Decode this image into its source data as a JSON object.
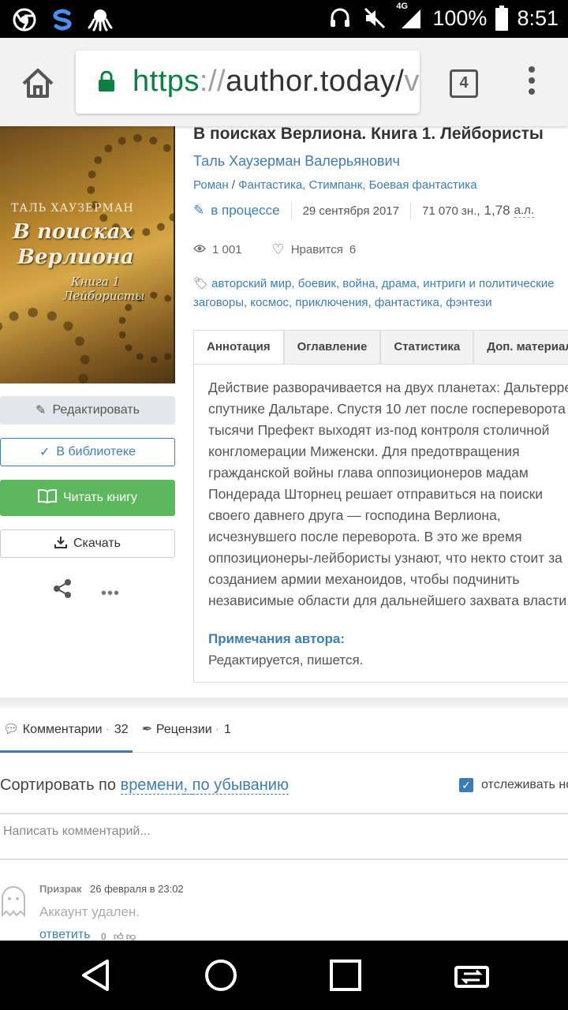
{
  "status_bar": {
    "network": "4G",
    "battery": "100%",
    "time": "8:51"
  },
  "browser": {
    "url_scheme": "https",
    "url_sep": "://",
    "url_host": "author.today/",
    "url_tail": "v",
    "tab_count": "4"
  },
  "book": {
    "title": "В поисках Верлиона. Книга 1. Лейбористы",
    "author": "Таль Хаузерман Валерьянович",
    "genre_type": "Роман",
    "genre_sep": " / ",
    "genres": "Фантастика, Стимпанк, Боевая фантастика",
    "status": "в процессе",
    "date": "29 сентября 2017",
    "chars": "71 070 зн.,",
    "sheets": "1,78",
    "sheets_unit": "а.л.",
    "views": "1 001",
    "likes_label": "Нравится",
    "likes": "6",
    "tags_line1": "авторский мир, боевик, война, драма, интриги и политические",
    "tags_line2": "заговоры, космос, приключения, фантастика, фэнтези",
    "cover": {
      "author": "ТАЛЬ ХАУЗЕРМАН",
      "title1": "В поисках",
      "title2": "Верлиона",
      "sub1": "Книга 1",
      "sub2": "Лейбористы"
    }
  },
  "tabs": [
    "Аннотация",
    "Оглавление",
    "Статистика",
    "Доп. материалы"
  ],
  "annotation": [
    "Действие разворачивается на двух планетах: Дальтерре и",
    "спутнике Дальтаре. Спустя 10 лет после госпереворота",
    "тысячи Префект выходят из-под контроля столичной",
    "конгломерации Миженски. Для предотвращения",
    "гражданской войны глава оппозиционеров мадам",
    "Пондерада Шторнец решает отправиться на поиски",
    "своего давнего друга — господина Верлиона,",
    "исчезнувшего после переворота. В это же время",
    "оппозиционеры-лейбористы узнают, что некто стоит за",
    "созданием армии механоидов, чтобы подчинить",
    "независимые области для дальнейшего захвата власти."
  ],
  "author_notes": {
    "title": "Примечания автора:",
    "text": "Редактируется, пишется."
  },
  "actions": {
    "edit": "Редактировать",
    "library": "В библиотеке",
    "read": "Читать книгу",
    "download": "Скачать"
  },
  "comments": {
    "tab_comments": "Комментарии",
    "comments_count": "32",
    "tab_reviews": "Рецензии",
    "reviews_count": "1",
    "sort_prefix": "Сортировать по ",
    "sort_by": "времени",
    "sort_sep": ", ",
    "sort_order": "по убыванию",
    "follow": "отслеживать новые",
    "input_placeholder": "Написать комментарий...",
    "items": [
      {
        "author": "Призрак",
        "date": "26 февраля в 23:02",
        "text": "Аккаунт удален.",
        "reply": "ответить",
        "votes": "0"
      }
    ]
  },
  "colors": {
    "link": "#3d7db5",
    "read_button": "#5cb85c",
    "url_secure": "#0b8043"
  }
}
